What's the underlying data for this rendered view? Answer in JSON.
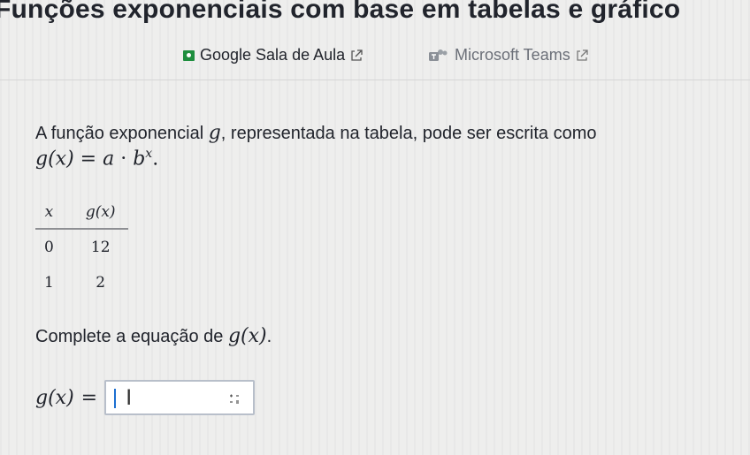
{
  "header": {
    "title": "Funções exponenciais com base em tabelas e gráfico"
  },
  "share": {
    "classroom_label": "Google Sala de Aula",
    "teams_label": "Microsoft Teams"
  },
  "problem": {
    "intro": "A função exponencial ",
    "fname": "g",
    "intro_rest": ", representada na tabela, pode ser escrita como",
    "formula_lhs": "g(x)",
    "formula_eq": " = ",
    "formula_a": "a",
    "formula_dot": " · ",
    "formula_b": "b",
    "formula_exp": "x",
    "formula_end": "."
  },
  "table": {
    "headers": [
      "x",
      "g(x)"
    ],
    "rows": [
      [
        "0",
        "12"
      ],
      [
        "1",
        "2"
      ]
    ]
  },
  "prompt": {
    "text": "Complete a equação de ",
    "fn": "g(x)",
    "end": "."
  },
  "answer": {
    "lhs": "g(x)",
    "eq": " = ",
    "value": "",
    "cursor_glyph": "I"
  },
  "icons": {
    "classroom": "google-classroom-icon",
    "teams": "microsoft-teams-icon",
    "external": "external-link-icon",
    "keyboard": "math-keypad-icon"
  },
  "colors": {
    "classroom_green": "#1e8e3e",
    "caret_blue": "#1c6fd1",
    "text": "#21242c"
  }
}
